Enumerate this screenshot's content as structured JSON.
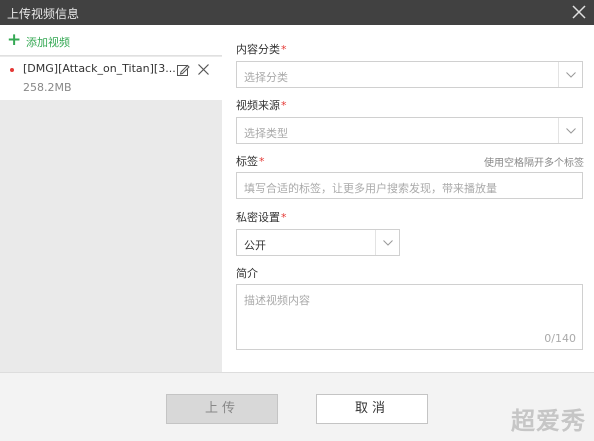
{
  "window": {
    "title": "上传视频信息",
    "close_icon": "close-icon"
  },
  "sidebar": {
    "add_label": "添加视频",
    "add_icon": "plus-icon",
    "files": [
      {
        "name": "[DMG][Attack_on_Titan][3...",
        "size": "258.2MB"
      }
    ]
  },
  "form": {
    "category": {
      "label": "内容分类",
      "required_mark": "*",
      "placeholder": "选择分类"
    },
    "source": {
      "label": "视频来源",
      "required_mark": "*",
      "placeholder": "选择类型"
    },
    "tags": {
      "label": "标签",
      "required_mark": "*",
      "hint": "使用空格隔开多个标签",
      "placeholder": "填写合适的标签，让更多用户搜索发现，带来播放量"
    },
    "privacy": {
      "label": "私密设置",
      "required_mark": "*",
      "value": "公开"
    },
    "intro": {
      "label": "简介",
      "placeholder": "描述视频内容",
      "counter": "0/140"
    }
  },
  "footer": {
    "upload_label": "上传",
    "cancel_label": "取消"
  },
  "watermark": "超爱秀",
  "colors": {
    "titlebar": "#414141",
    "accent_green": "#34a853",
    "required_red": "#e53935"
  }
}
